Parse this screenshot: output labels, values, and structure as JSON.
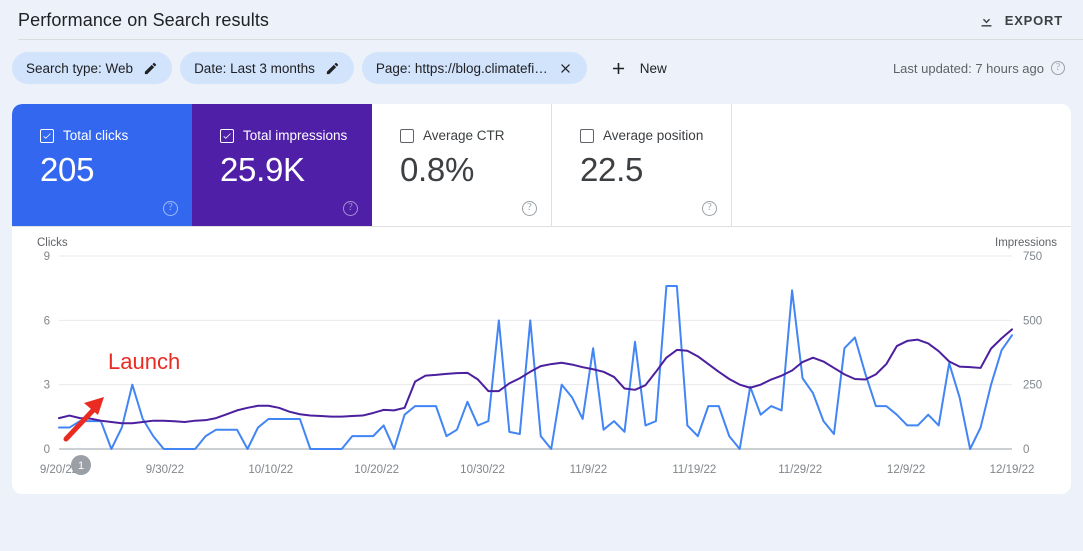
{
  "header": {
    "title": "Performance on Search results",
    "export_label": "EXPORT",
    "export_icon": "download-icon"
  },
  "filters": {
    "chips": [
      {
        "label": "Search type: Web",
        "icon": "pencil-icon",
        "removable": false
      },
      {
        "label": "Date: Last 3 months",
        "icon": "pencil-icon",
        "removable": false
      },
      {
        "label": "Page: https://blog.climatefi…",
        "icon": "close-icon",
        "removable": true
      }
    ],
    "new_label": "New",
    "new_icon": "plus-icon",
    "last_updated": "Last updated: 7 hours ago",
    "help_icon": "help-circle-icon"
  },
  "metrics": [
    {
      "label": "Total clicks",
      "value": "205",
      "checked": true,
      "color": "#3367F0",
      "state": "active-blue"
    },
    {
      "label": "Total impressions",
      "value": "25.9K",
      "checked": true,
      "color": "#4F1FA8",
      "state": "active-purple"
    },
    {
      "label": "Average CTR",
      "value": "0.8%",
      "checked": false,
      "color": "#FFFFFF",
      "state": "inactive"
    },
    {
      "label": "Average position",
      "value": "22.5",
      "checked": false,
      "color": "#FFFFFF",
      "state": "inactive"
    }
  ],
  "annotation": {
    "label": "Launch",
    "color": "#EA2B22",
    "marker_label": "1"
  },
  "chart_data": {
    "type": "line",
    "title": "",
    "xlabel": "",
    "ylabel": "Clicks",
    "y2label": "Impressions",
    "ylim": [
      0,
      9
    ],
    "y2lim": [
      0,
      750
    ],
    "yticks": [
      "0",
      "3",
      "6",
      "9"
    ],
    "y2ticks": [
      "0",
      "250",
      "500",
      "750"
    ],
    "grid": true,
    "legend": "none",
    "xticklabels": [
      "9/20/22",
      "9/30/22",
      "10/10/22",
      "10/20/22",
      "10/30/22",
      "11/9/22",
      "11/19/22",
      "11/29/22",
      "12/9/22",
      "12/19/22"
    ],
    "x_start": "9/20/22",
    "x_end": "12/19/22",
    "n_points": 91,
    "series": [
      {
        "name": "Total clicks",
        "color": "#4285F4",
        "axis": "left",
        "values": [
          1,
          1,
          1.3,
          1.3,
          1.3,
          0,
          1,
          3,
          1.4,
          0.6,
          0,
          0,
          0,
          0,
          0.6,
          0.9,
          0.9,
          0.9,
          0,
          1,
          1.4,
          1.4,
          1.4,
          1.4,
          0,
          0,
          0,
          0,
          0.6,
          0.6,
          0.6,
          1.1,
          0,
          1.6,
          2,
          2,
          2,
          0.6,
          0.9,
          2.2,
          1.1,
          1.3,
          6,
          0.8,
          0.7,
          6,
          0.6,
          0,
          3,
          2.4,
          1.4,
          4.7,
          0.9,
          1.3,
          0.8,
          5,
          1.1,
          1.3,
          7.6,
          7.6,
          1.1,
          0.6,
          2,
          2,
          0.6,
          0,
          2.9,
          1.6,
          2,
          1.8,
          7.4,
          3.3,
          2.6,
          1.3,
          0.7,
          4.7,
          5.2,
          3.5,
          2,
          2,
          1.6,
          1.1,
          1.1,
          1.6,
          1.1,
          4,
          2.4,
          0,
          1,
          3,
          4.6,
          5.3
        ]
      },
      {
        "name": "Total impressions",
        "color": "#4B1F9E",
        "axis": "right",
        "values": [
          120,
          130,
          120,
          118,
          110,
          105,
          100,
          100,
          105,
          110,
          110,
          108,
          105,
          110,
          112,
          120,
          135,
          150,
          160,
          168,
          168,
          160,
          145,
          135,
          130,
          128,
          126,
          126,
          128,
          130,
          140,
          152,
          150,
          160,
          262,
          285,
          288,
          292,
          295,
          296,
          270,
          225,
          225,
          255,
          275,
          300,
          322,
          330,
          335,
          328,
          318,
          310,
          300,
          280,
          235,
          230,
          248,
          300,
          355,
          385,
          382,
          360,
          330,
          300,
          272,
          250,
          238,
          250,
          270,
          285,
          305,
          338,
          355,
          340,
          315,
          290,
          272,
          270,
          290,
          330,
          400,
          420,
          425,
          410,
          380,
          340,
          320,
          318,
          315,
          390,
          430,
          465
        ]
      }
    ]
  }
}
